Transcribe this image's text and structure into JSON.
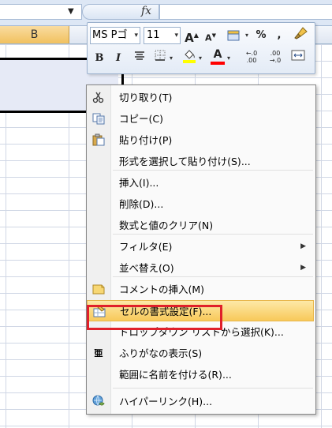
{
  "formula_bar": {
    "fx_label": "fx",
    "namebox_arrow": "▼"
  },
  "column_header": {
    "b_label": "B"
  },
  "mini_toolbar": {
    "font_name": "MS Pゴ",
    "font_size": "11",
    "grow_font": "A",
    "shrink_font": "A",
    "percent": "%",
    "comma": ",",
    "bold": "B",
    "italic": "I",
    "font_color_letter": "A",
    "increase_decimal": "←.0\n.00",
    "decrease_decimal": ".00\n→.0",
    "accent_fill": "#ffff00",
    "accent_font": "#ff0000"
  },
  "context_menu": {
    "items": [
      {
        "label": "切り取り(T)",
        "icon": "scissors-icon"
      },
      {
        "label": "コピー(C)",
        "icon": "copy-icon"
      },
      {
        "label": "貼り付け(P)",
        "icon": "paste-icon"
      },
      {
        "label": "形式を選択して貼り付け(S)..."
      },
      {
        "label": "挿入(I)..."
      },
      {
        "label": "削除(D)..."
      },
      {
        "label": "数式と値のクリア(N)"
      },
      {
        "label": "フィルタ(E)",
        "submenu": true
      },
      {
        "label": "並べ替え(O)",
        "submenu": true
      },
      {
        "label": "コメントの挿入(M)",
        "icon": "comment-icon"
      },
      {
        "label": "セルの書式設定(F)...",
        "icon": "format-cells-icon",
        "highlighted": true
      },
      {
        "label": "ドロップダウン リストから選択(K)..."
      },
      {
        "label": "ふりがなの表示(S)",
        "icon": "furigana-icon"
      },
      {
        "label": "範囲に名前を付ける(R)..."
      },
      {
        "label": "ハイパーリンク(H)...",
        "icon": "hyperlink-icon"
      }
    ],
    "submenu_arrow": "▶",
    "furigana_glyph": "亜"
  }
}
